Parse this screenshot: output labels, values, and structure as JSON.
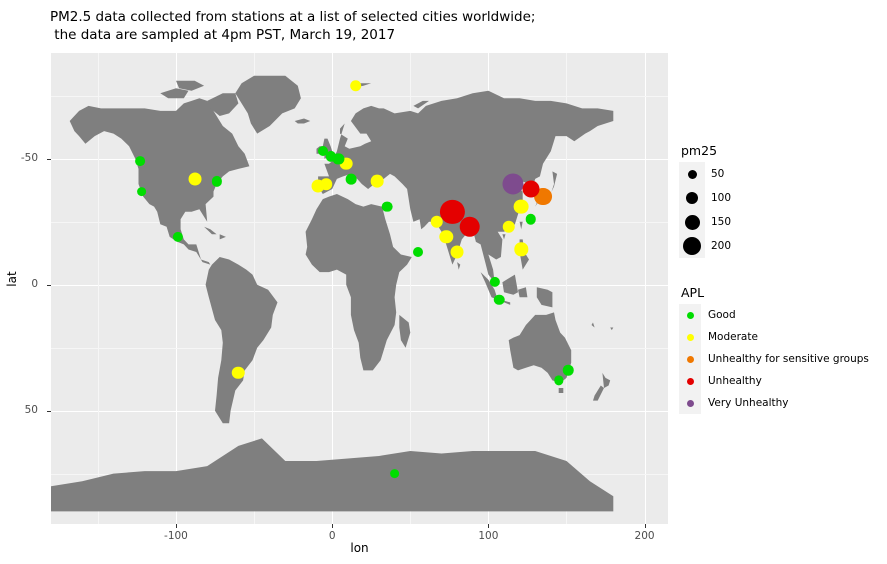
{
  "title": {
    "line1": "PM2.5 data collected from stations at a list of selected cities worldwide;",
    "line2": " the data are sampled at 4pm PST, March 19, 2017"
  },
  "axes": {
    "x_label": "lon",
    "y_label": "lat",
    "x_ticks": [
      "-100",
      "0",
      "100",
      "200"
    ],
    "y_ticks": [
      "50",
      "0",
      "-50"
    ]
  },
  "size_legend": {
    "title": "pm25",
    "items": [
      {
        "label": "50",
        "diameter": 9
      },
      {
        "label": "100",
        "diameter": 12
      },
      {
        "label": "150",
        "diameter": 15
      },
      {
        "label": "200",
        "diameter": 18
      }
    ]
  },
  "color_legend": {
    "title": "APL",
    "items": [
      {
        "label": "Good",
        "color": "#00DD00"
      },
      {
        "label": "Moderate",
        "color": "#FFFF00"
      },
      {
        "label": "Unhealthy for sensitive groups",
        "color": "#F07800"
      },
      {
        "label": "Unhealthy",
        "color": "#E40000"
      },
      {
        "label": "Very Unhealthy",
        "color": "#7E4B8E"
      }
    ]
  },
  "colors": {
    "panel_background": "#EBEBEB",
    "gridline": "#FFFFFF",
    "land": "#7F7F7F",
    "plot_text": "#4D4D4D"
  },
  "chart_data": {
    "type": "scatter",
    "title": "PM2.5 data collected from stations at a list of selected cities worldwide; the data are sampled at 4pm PST, March 19, 2017",
    "xlabel": "lon",
    "ylabel": "lat",
    "xlim": [
      -180,
      215
    ],
    "ylim": [
      -95,
      92
    ],
    "xticks": [
      -100,
      0,
      100,
      200
    ],
    "yticks": [
      -50,
      0,
      50
    ],
    "grid": true,
    "legend_position": "right",
    "size_variable": "pm25",
    "size_breaks": [
      50,
      100,
      150,
      200
    ],
    "color_variable": "APL",
    "color_levels": [
      "Good",
      "Moderate",
      "Unhealthy for sensitive groups",
      "Unhealthy",
      "Very Unhealthy"
    ],
    "background_layer": "world map (land filled grey)",
    "points": [
      {
        "lon": 15,
        "lat": 79,
        "pm25": 60,
        "apl": "Moderate",
        "color": "#FFFF00"
      },
      {
        "lon": -123,
        "lat": 49,
        "pm25": 40,
        "apl": "Good",
        "color": "#00DD00"
      },
      {
        "lon": -122,
        "lat": 37,
        "pm25": 40,
        "apl": "Good",
        "color": "#00DD00"
      },
      {
        "lon": -88,
        "lat": 42,
        "pm25": 75,
        "apl": "Moderate",
        "color": "#FFFF00"
      },
      {
        "lon": -74,
        "lat": 41,
        "pm25": 45,
        "apl": "Good",
        "color": "#00DD00"
      },
      {
        "lon": -99,
        "lat": 19,
        "pm25": 45,
        "apl": "Good",
        "color": "#00DD00"
      },
      {
        "lon": -60,
        "lat": -35,
        "pm25": 70,
        "apl": "Moderate",
        "color": "#FFFF00"
      },
      {
        "lon": -9,
        "lat": 39,
        "pm25": 75,
        "apl": "Moderate",
        "color": "#FFFF00"
      },
      {
        "lon": -4,
        "lat": 40,
        "pm25": 60,
        "apl": "Moderate",
        "color": "#FFFF00"
      },
      {
        "lon": -6,
        "lat": 53,
        "pm25": 42,
        "apl": "Good",
        "color": "#00DD00"
      },
      {
        "lon": -1,
        "lat": 51,
        "pm25": 45,
        "apl": "Good",
        "color": "#00DD00"
      },
      {
        "lon": 4,
        "lat": 50,
        "pm25": 55,
        "apl": "Good",
        "color": "#00DD00"
      },
      {
        "lon": 9,
        "lat": 48,
        "pm25": 72,
        "apl": "Moderate",
        "color": "#FFFF00"
      },
      {
        "lon": 12,
        "lat": 42,
        "pm25": 50,
        "apl": "Good",
        "color": "#00DD00"
      },
      {
        "lon": 29,
        "lat": 41,
        "pm25": 72,
        "apl": "Moderate",
        "color": "#FFFF00"
      },
      {
        "lon": 35,
        "lat": 31,
        "pm25": 50,
        "apl": "Good",
        "color": "#00DD00"
      },
      {
        "lon": 55,
        "lat": 13,
        "pm25": 42,
        "apl": "Good",
        "color": "#00DD00"
      },
      {
        "lon": 67,
        "lat": 25,
        "pm25": 70,
        "apl": "Moderate",
        "color": "#FFFF00"
      },
      {
        "lon": 77,
        "lat": 29,
        "pm25": 200,
        "apl": "Unhealthy",
        "color": "#E40000"
      },
      {
        "lon": 88,
        "lat": 23,
        "pm25": 160,
        "apl": "Unhealthy",
        "color": "#E40000"
      },
      {
        "lon": 73,
        "lat": 19,
        "pm25": 80,
        "apl": "Moderate",
        "color": "#FFFF00"
      },
      {
        "lon": 80,
        "lat": 13,
        "pm25": 75,
        "apl": "Moderate",
        "color": "#FFFF00"
      },
      {
        "lon": 116,
        "lat": 40,
        "pm25": 165,
        "apl": "Very Unhealthy",
        "color": "#7E4B8E"
      },
      {
        "lon": 127,
        "lat": 38,
        "pm25": 120,
        "apl": "Unhealthy",
        "color": "#E40000"
      },
      {
        "lon": 135,
        "lat": 35,
        "pm25": 130,
        "apl": "Unhealthy for sensitive groups",
        "color": "#F07800"
      },
      {
        "lon": 121,
        "lat": 31,
        "pm25": 95,
        "apl": "Moderate",
        "color": "#FFFF00"
      },
      {
        "lon": 127,
        "lat": 26,
        "pm25": 48,
        "apl": "Good",
        "color": "#00DD00"
      },
      {
        "lon": 113,
        "lat": 23,
        "pm25": 70,
        "apl": "Moderate",
        "color": "#FFFF00"
      },
      {
        "lon": 121,
        "lat": 14,
        "pm25": 80,
        "apl": "Moderate",
        "color": "#FFFF00"
      },
      {
        "lon": 104,
        "lat": 1,
        "pm25": 45,
        "apl": "Good",
        "color": "#00DD00"
      },
      {
        "lon": 107,
        "lat": -6,
        "pm25": 48,
        "apl": "Good",
        "color": "#00DD00"
      },
      {
        "lon": 151,
        "lat": -34,
        "pm25": 48,
        "apl": "Good",
        "color": "#00DD00"
      },
      {
        "lon": 145,
        "lat": -38,
        "pm25": 35,
        "apl": "Good",
        "color": "#00DD00"
      },
      {
        "lon": 40,
        "lat": -75,
        "pm25": 40,
        "apl": "Good",
        "color": "#00DD00"
      }
    ]
  }
}
